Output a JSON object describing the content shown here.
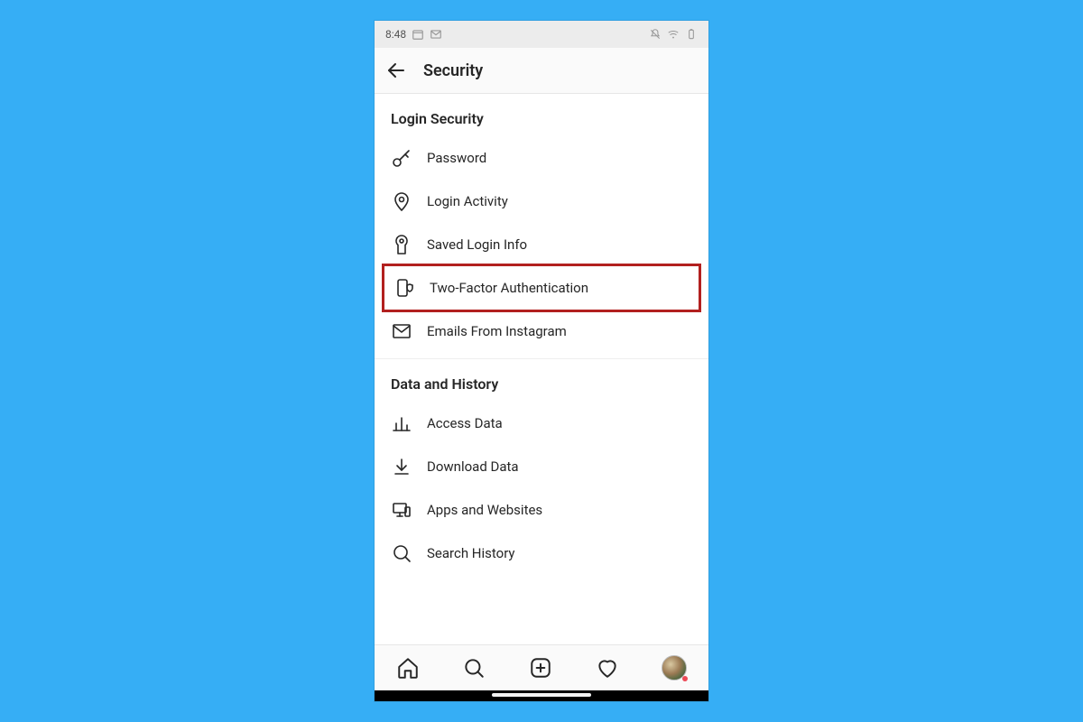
{
  "status": {
    "time": "8:48"
  },
  "title": "Security",
  "highlightId": "two-factor",
  "sections": [
    {
      "header": "Login Security",
      "items": [
        {
          "id": "password",
          "label": "Password",
          "icon": "key-icon"
        },
        {
          "id": "login-activity",
          "label": "Login Activity",
          "icon": "location-pin-icon"
        },
        {
          "id": "saved-login",
          "label": "Saved Login Info",
          "icon": "keyhole-icon"
        },
        {
          "id": "two-factor",
          "label": "Two-Factor Authentication",
          "icon": "phone-shield-icon"
        },
        {
          "id": "emails",
          "label": "Emails From Instagram",
          "icon": "mail-icon"
        }
      ]
    },
    {
      "header": "Data and History",
      "items": [
        {
          "id": "access-data",
          "label": "Access Data",
          "icon": "bar-chart-icon"
        },
        {
          "id": "download-data",
          "label": "Download Data",
          "icon": "download-icon"
        },
        {
          "id": "apps-websites",
          "label": "Apps and Websites",
          "icon": "devices-icon"
        },
        {
          "id": "search-history",
          "label": "Search History",
          "icon": "search-icon"
        }
      ]
    }
  ]
}
